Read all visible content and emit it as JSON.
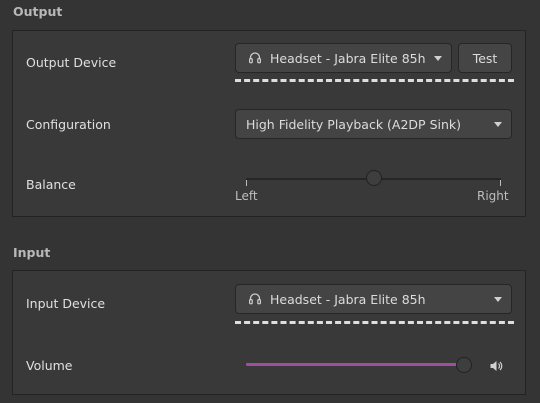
{
  "output": {
    "section_title": "Output",
    "device_label": "Output Device",
    "device_value": "Headset - Jabra Elite 85h",
    "device_icon": "headset-icon",
    "test_label": "Test",
    "config_label": "Configuration",
    "config_value": "High Fidelity Playback (A2DP Sink)",
    "balance_label": "Balance",
    "balance_value": 0.5,
    "balance_left": "Left",
    "balance_right": "Right"
  },
  "input": {
    "section_title": "Input",
    "device_label": "Input Device",
    "device_value": "Headset - Jabra Elite 85h",
    "device_icon": "headset-icon",
    "volume_label": "Volume",
    "volume_fraction": 1.0,
    "volume_icon": "speaker-icon"
  },
  "colors": {
    "accent": "#a04f9f",
    "background": "#343434",
    "panel": "#393939"
  }
}
